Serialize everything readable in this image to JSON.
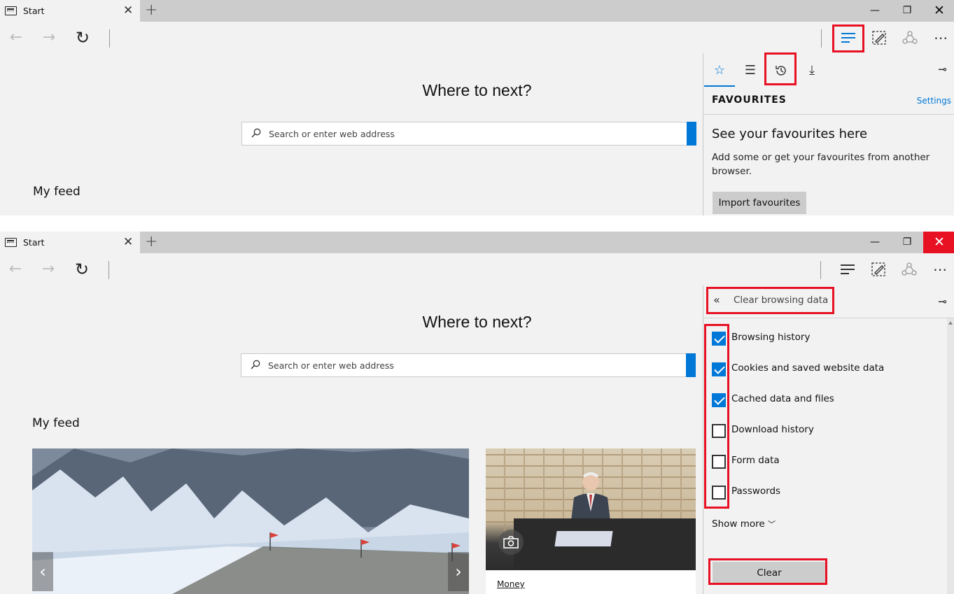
{
  "colors": {
    "accent": "#0078d7",
    "highlight_box": "#e81123",
    "close_hover": "#e81123",
    "chrome_bg": "#f2f2f2",
    "tabstrip_bg": "#cccccc"
  },
  "top": {
    "tab": {
      "title": "Start"
    },
    "page": {
      "heading": "Where to next?",
      "search_placeholder": "Search or enter web address",
      "feed_label": "My feed"
    },
    "hub": {
      "section_title": "FAVOURITES",
      "settings_label": "Settings",
      "headline": "See your favourites here",
      "description": "Add some or get your favourites from another browser.",
      "import_label": "Import favourites"
    }
  },
  "bottom": {
    "tab": {
      "title": "Start"
    },
    "page": {
      "heading": "Where to next?",
      "search_placeholder": "Search or enter web address",
      "feed_label": "My feed",
      "money_card_label": "Money"
    },
    "clear_panel": {
      "title": "Clear browsing data",
      "options": [
        {
          "label": "Browsing history",
          "checked": true
        },
        {
          "label": "Cookies and saved website data",
          "checked": true
        },
        {
          "label": "Cached data and files",
          "checked": true
        },
        {
          "label": "Download history",
          "checked": false
        },
        {
          "label": "Form data",
          "checked": false
        },
        {
          "label": "Passwords",
          "checked": false
        }
      ],
      "show_more_label": "Show more",
      "clear_label": "Clear"
    }
  },
  "icons": {
    "tab": "browser-page-icon",
    "close_tab": "close-icon",
    "new_tab": "plus-icon",
    "back": "arrow-left-icon",
    "forward": "arrow-right-icon",
    "refresh": "refresh-icon",
    "hub": "hub-icon",
    "web_note": "pen-note-icon",
    "share": "share-icon",
    "more": "more-dots-icon",
    "favourites_tab": "star-icon",
    "reading_list_tab": "reading-list-icon",
    "history_tab": "history-icon",
    "downloads_tab": "download-icon",
    "pin": "pin-icon",
    "back_panel": "double-chevron-left-icon",
    "camera": "camera-icon"
  }
}
